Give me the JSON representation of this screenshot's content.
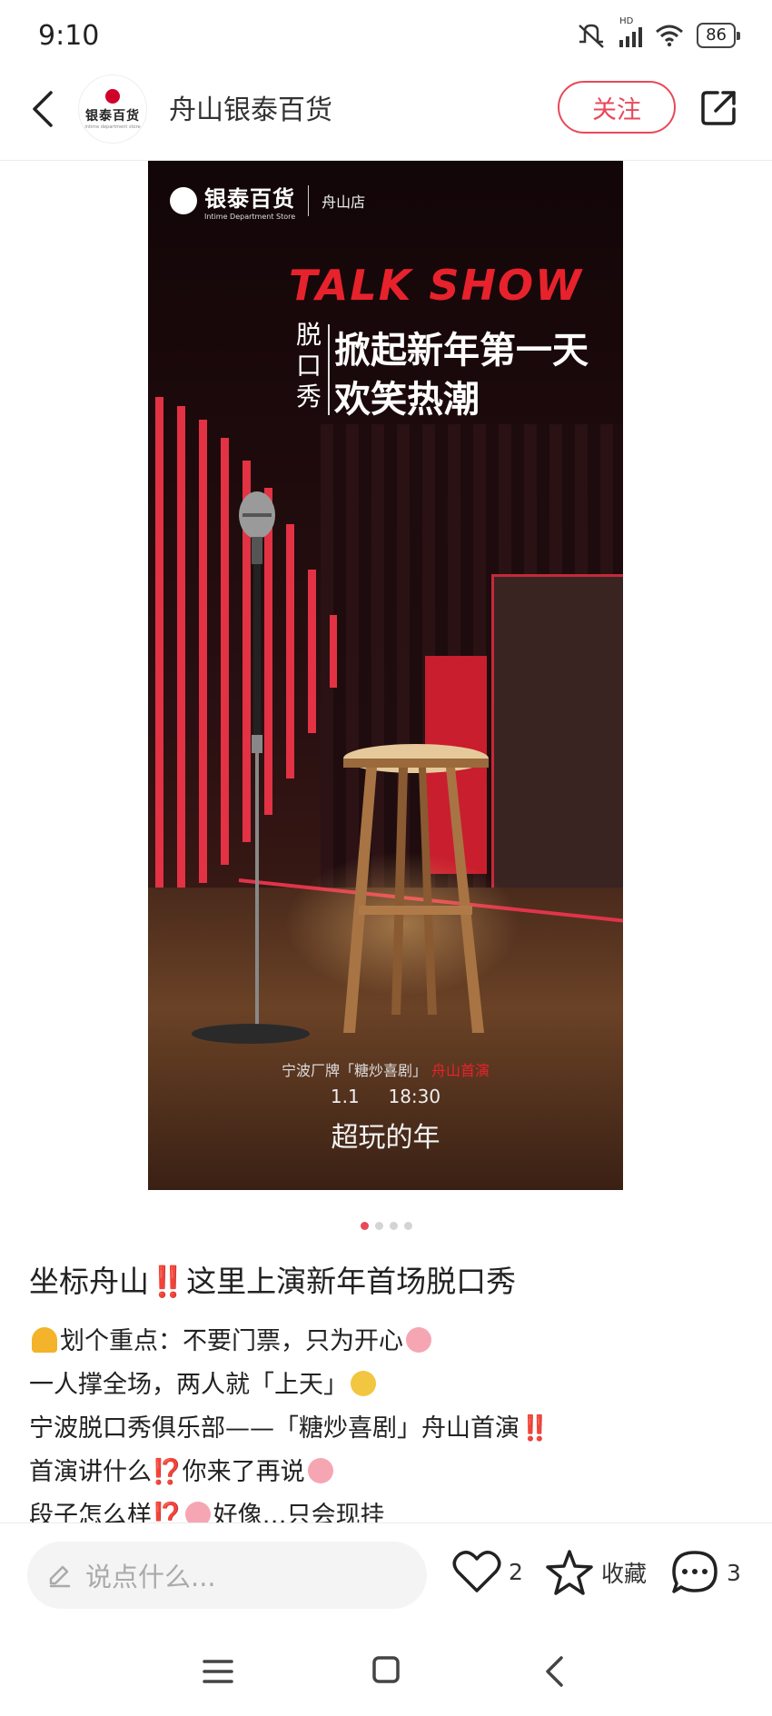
{
  "status_bar": {
    "time": "9:10",
    "network": "HD",
    "battery": "86"
  },
  "header": {
    "avatar_text": "银泰百货",
    "avatar_sub": "intime department store",
    "store_name": "舟山银泰百货",
    "follow_label": "关注"
  },
  "poster": {
    "logo_cn": "银泰百货",
    "logo_en": "Intime Department Store",
    "branch": "舟山店",
    "talk_show": "TALK SHOW",
    "vertical_label": "脱口秀",
    "headline_1": "掀起新年第一天",
    "headline_2": "欢笑热潮",
    "event_organizer": "宁波厂牌「糖炒喜剧」",
    "event_premiere": "舟山首演",
    "event_date": "1.1",
    "event_time": "18:30",
    "event_brand": "超玩的年"
  },
  "carousel": {
    "count": 4,
    "active_index": 0
  },
  "post": {
    "title_a": "坐标舟山",
    "title_bang": "‼️",
    "title_b": "这里上演新年首场脱口秀",
    "lines": [
      {
        "pre_emoji": "bell",
        "text": "划个重点：不要门票，只为开心",
        "post_emoji": "pig"
      },
      {
        "text": "一人撑全场，两人就「上天」",
        "post_emoji": "cool"
      },
      {
        "text": "宁波脱口秀俱乐部——「糖炒喜剧」舟山首演",
        "post_bang": "‼️"
      },
      {
        "text_a": "首演讲什么",
        "bang": "⁉️",
        "text_b": "你来了再说",
        "post_emoji": "pig"
      },
      {
        "text_a": "段子怎么样",
        "bang": "⁉️",
        "text_b": "好像…只会现挂"
      }
    ]
  },
  "bottom_bar": {
    "comment_placeholder": "说点什么...",
    "like_count": "2",
    "favorite_label": "收藏",
    "comment_count": "3"
  },
  "icons": [
    "back-icon",
    "share-icon",
    "pen-icon",
    "heart-icon",
    "star-icon",
    "comment-icon",
    "nav-menu-icon",
    "nav-home-icon",
    "nav-back-icon",
    "wifi-icon",
    "signal-icon",
    "mute-icon"
  ],
  "colors": {
    "accent": "#e8485a",
    "poster_red": "#e8222c"
  }
}
